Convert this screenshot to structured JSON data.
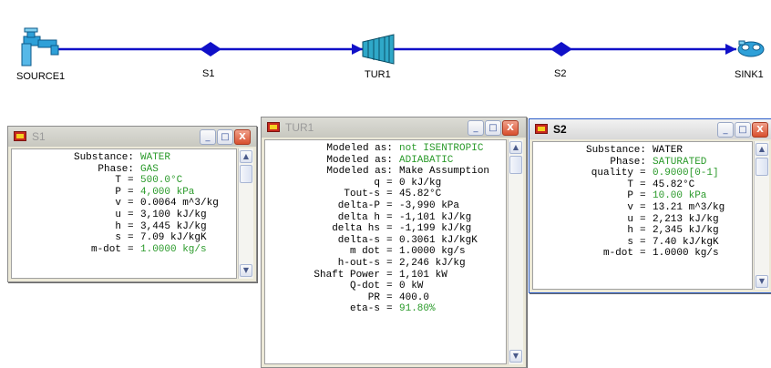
{
  "flowsheet": {
    "nodes": [
      {
        "label": "SOURCE1",
        "icon": "faucet-icon"
      },
      {
        "label": "S1",
        "icon": "stream-node-icon"
      },
      {
        "label": "TUR1",
        "icon": "turbine-icon"
      },
      {
        "label": "S2",
        "icon": "stream-node-icon"
      },
      {
        "label": "SINK1",
        "icon": "sink-icon"
      }
    ],
    "line_color": "#1010c8"
  },
  "windows": {
    "s1": {
      "title": "S1",
      "rows": [
        {
          "label": "Substance:",
          "value": "WATER"
        },
        {
          "label": "Phase:",
          "value": "GAS"
        },
        {
          "label": "T",
          "value": "500.0°C"
        },
        {
          "label": "P",
          "value": "4,000 kPa"
        },
        {
          "label": "v",
          "value": "0.0064 m^3/kg",
          "black": true
        },
        {
          "label": "u",
          "value": "3,100 kJ/kg",
          "black": true
        },
        {
          "label": "h",
          "value": "3,445 kJ/kg",
          "black": true
        },
        {
          "label": "s",
          "value": "7.09 kJ/kgK",
          "black": true
        },
        {
          "label": "m-dot",
          "value": "1.0000 kg/s"
        }
      ]
    },
    "tur1": {
      "title": "TUR1",
      "rows": [
        {
          "label": "Modeled as:",
          "value": "not ISENTROPIC"
        },
        {
          "label": "Modeled as:",
          "value": "ADIABATIC"
        },
        {
          "label": "Modeled as:",
          "value": "Make Assumption",
          "black": true
        },
        {
          "label": "q",
          "value": "0 kJ/kg",
          "black": true
        },
        {
          "label": "Tout-s",
          "value": "45.82°C",
          "black": true
        },
        {
          "label": "delta-P",
          "value": "-3,990 kPa",
          "black": true
        },
        {
          "label": "delta h",
          "value": "-1,101 kJ/kg",
          "black": true
        },
        {
          "label": "delta hs",
          "value": "-1,199 kJ/kg",
          "black": true
        },
        {
          "label": "delta-s",
          "value": "0.3061 kJ/kgK",
          "black": true
        },
        {
          "label": "m dot",
          "value": "1.0000 kg/s",
          "black": true
        },
        {
          "label": "h-out-s",
          "value": "2,246 kJ/kg",
          "black": true
        },
        {
          "label": "Shaft Power",
          "value": "1,101 kW",
          "black": true
        },
        {
          "label": "Q-dot",
          "value": "0 kW",
          "black": true
        },
        {
          "label": "PR",
          "value": "400.0",
          "black": true
        },
        {
          "label": "eta-s",
          "value": "91.80%"
        }
      ]
    },
    "s2": {
      "title": "S2",
      "rows": [
        {
          "label": "Substance:",
          "value": "WATER",
          "black": true
        },
        {
          "label": "Phase:",
          "value": "SATURATED"
        },
        {
          "label": "quality",
          "value": "0.9000[0-1]"
        },
        {
          "label": "T",
          "value": "45.82°C",
          "black": true
        },
        {
          "label": "P",
          "value": "10.00 kPa"
        },
        {
          "label": "v",
          "value": "13.21 m^3/kg",
          "black": true
        },
        {
          "label": "u",
          "value": "2,213 kJ/kg",
          "black": true
        },
        {
          "label": "h",
          "value": "2,345 kJ/kg",
          "black": true
        },
        {
          "label": "s",
          "value": "7.40 kJ/kgK",
          "black": true
        },
        {
          "label": "m-dot",
          "value": "1.0000 kg/s",
          "black": true
        }
      ]
    }
  },
  "window_buttons": {
    "minimize": "_",
    "maximize": "□",
    "close": "X"
  },
  "scroll_arrows": {
    "up": "▲",
    "down": "▼"
  }
}
